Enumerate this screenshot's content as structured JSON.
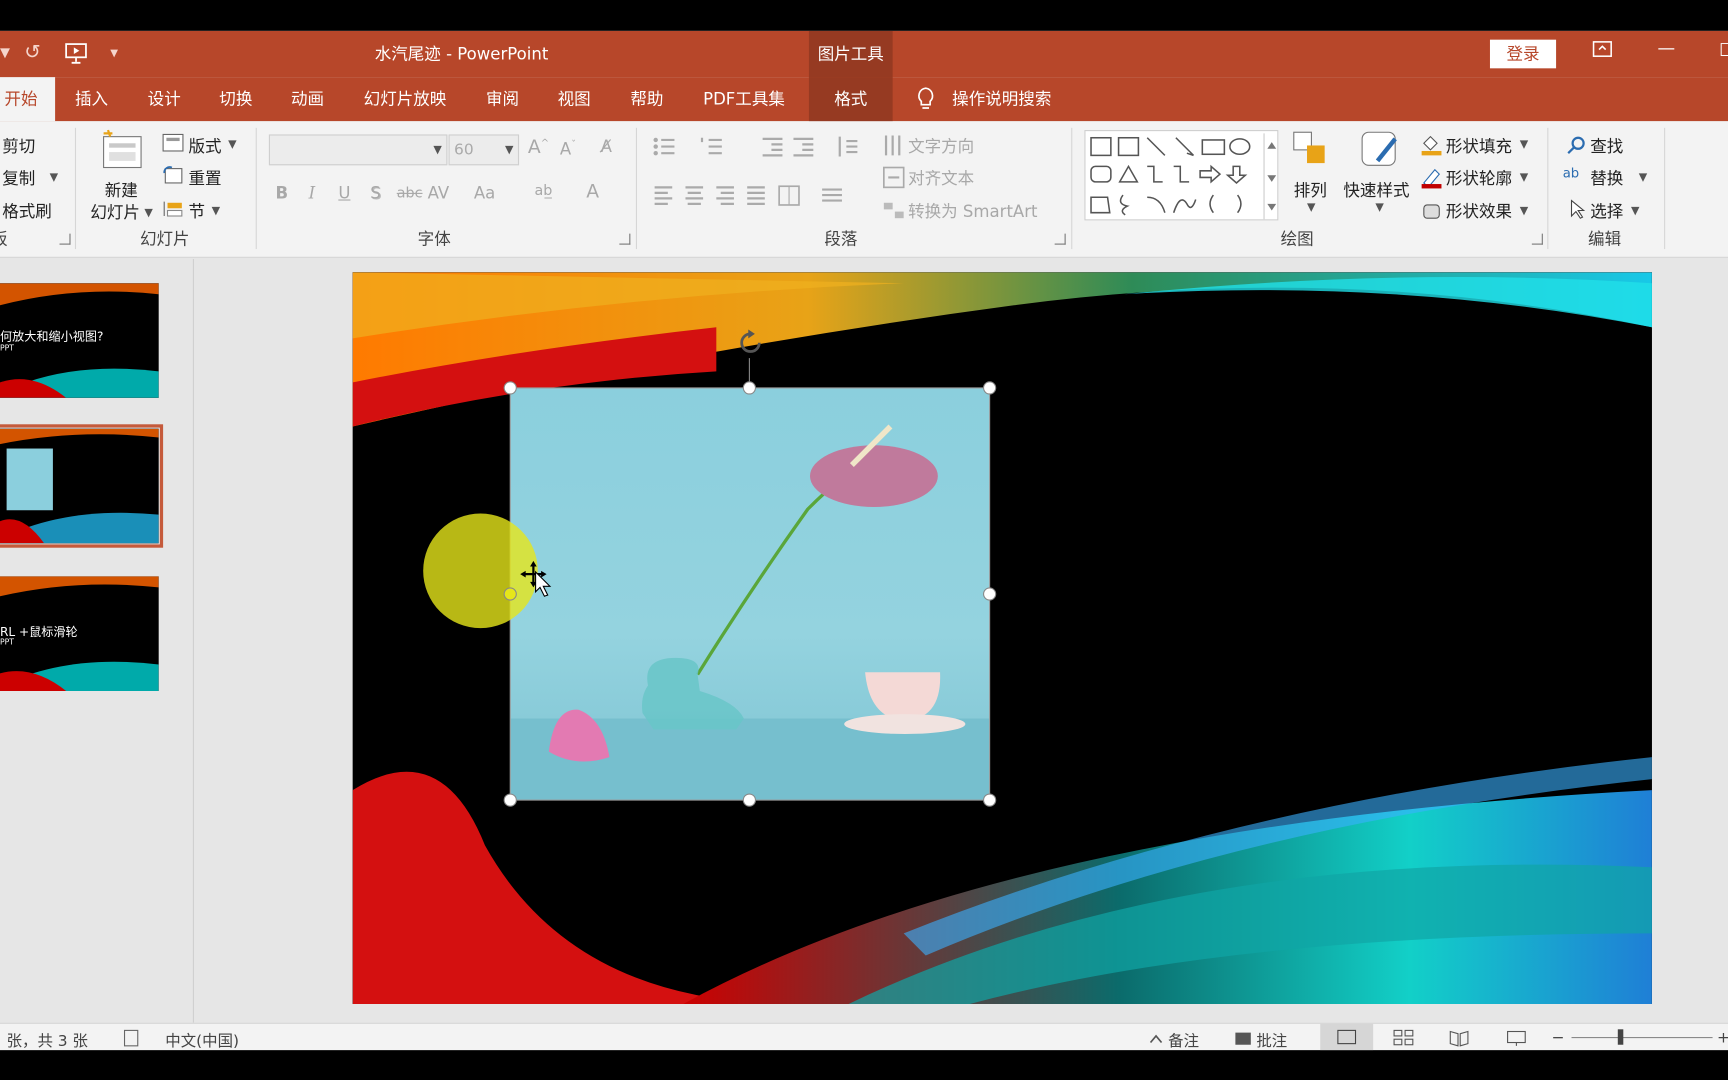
{
  "window": {
    "title": "水汽尾迹 - PowerPoint",
    "context_group": "图片工具",
    "login": "登录"
  },
  "tabs": [
    "开始",
    "插入",
    "设计",
    "切换",
    "动画",
    "幻灯片放映",
    "审阅",
    "视图",
    "帮助",
    "PDF工具集",
    "格式"
  ],
  "tell_me": "操作说明搜索",
  "ribbon": {
    "clipboard": {
      "cut": "剪切",
      "copy": "复制",
      "format_painter": "格式刷",
      "group": "板"
    },
    "slides": {
      "new_slide_1": "新建",
      "new_slide_2": "幻灯片",
      "layout": "版式",
      "reset": "重置",
      "section": "节",
      "group": "幻灯片"
    },
    "font": {
      "size": "60",
      "bold": "B",
      "italic": "I",
      "underline": "U",
      "shadow": "S",
      "strike": "abc",
      "spacing": "AV",
      "case": "Aa",
      "group": "字体"
    },
    "paragraph": {
      "text_direction": "文字方向",
      "align_text": "对齐文本",
      "smartart": "转换为 SmartArt",
      "group": "段落"
    },
    "drawing": {
      "arrange": "排列",
      "quick_styles": "快速样式",
      "fill": "形状填充",
      "outline": "形状轮廓",
      "effects": "形状效果",
      "group": "绘图"
    },
    "editing": {
      "find": "查找",
      "replace": "替换",
      "select": "选择",
      "group": "编辑"
    }
  },
  "thumbnails": [
    {
      "title": "何放大和缩小视图?",
      "sub": "PPT"
    },
    {
      "title": "",
      "sub": ""
    },
    {
      "title": "RL +鼠标滑轮",
      "sub": "PPT"
    }
  ],
  "statusbar": {
    "slide_info": "张，共 3 张",
    "language": "中文(中国)",
    "notes": "备注",
    "comments": "批注"
  },
  "colors": {
    "accent": "#b7472a",
    "context": "#963a22",
    "ribbon": "#f3f3f3"
  }
}
